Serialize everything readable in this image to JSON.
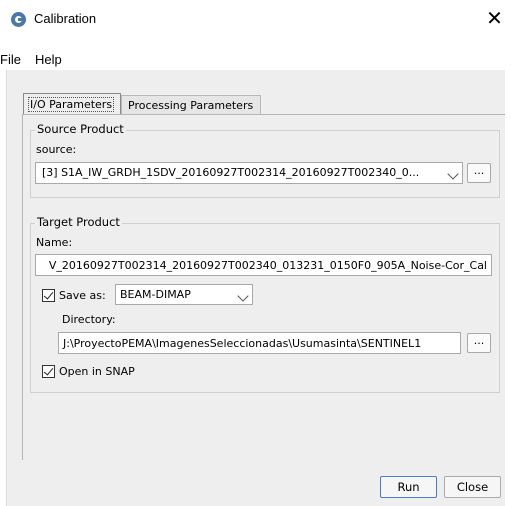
{
  "window": {
    "title": "Calibration",
    "close_glyph": "✕"
  },
  "menu": {
    "items": [
      "File",
      "Help"
    ]
  },
  "tabs": {
    "io": "I/O Parameters",
    "processing": "Processing Parameters"
  },
  "source_product": {
    "group_title": "Source Product",
    "source_label": "source:",
    "source_value": "[3] S1A_IW_GRDH_1SDV_20160927T002314_20160927T002340_0...",
    "browse_label": "..."
  },
  "target_product": {
    "group_title": "Target Product",
    "name_label": "Name:",
    "name_value": "V_20160927T002314_20160927T002340_013231_0150F0_905A_Noise-Cor_Cal",
    "save_as_label": "Save as:",
    "save_as_checked": true,
    "format_value": "BEAM-DIMAP",
    "directory_label": "Directory:",
    "directory_value": "J:\\ProyectoPEMA\\ImagenesSeleccionadas\\Usumasinta\\SENTINEL1",
    "browse_label": "...",
    "open_in_snap_label": "Open in SNAP",
    "open_in_snap_checked": true
  },
  "buttons": {
    "run": "Run",
    "close": "Close"
  },
  "icons": {
    "app": "snap-app-icon",
    "close": "close-icon",
    "dropdown": "chevron-down-icon",
    "check": "check-icon"
  }
}
